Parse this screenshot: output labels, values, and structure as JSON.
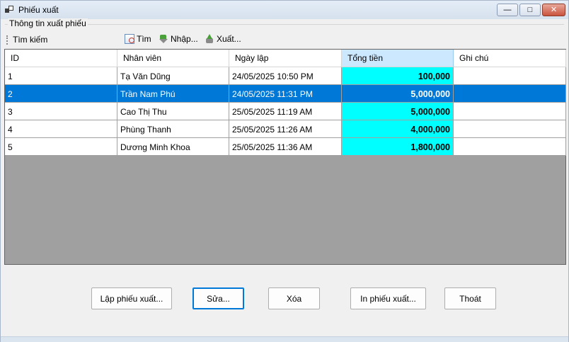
{
  "window": {
    "title": "Phiếu xuất",
    "minimize_glyph": "—",
    "maximize_glyph": "□",
    "close_glyph": "✕"
  },
  "group": {
    "title": "Thông tin xuất phiếu"
  },
  "toolbar": {
    "search_label": "Tìm kiếm",
    "find_label": "Tìm",
    "find_icon": "find-icon",
    "import_label": "Nhập...",
    "import_icon": "import-arrow-icon",
    "export_label": "Xuất...",
    "export_icon": "export-arrow-icon"
  },
  "grid": {
    "columns": [
      "ID",
      "Nhân viên",
      "Ngày lập",
      "Tổng tiền",
      "Ghi chú"
    ],
    "selected_column": 3,
    "selected_row": 1,
    "rows": [
      [
        "1",
        "Tạ Văn Dũng",
        "24/05/2025 10:50 PM",
        "100,000",
        ""
      ],
      [
        "2",
        "Trần Nam Phú",
        "24/05/2025 11:31 PM",
        "5,000,000",
        ""
      ],
      [
        "3",
        "Cao Thị Thu",
        "25/05/2025 11:19 AM",
        "5,000,000",
        ""
      ],
      [
        "4",
        "Phùng Thanh",
        "25/05/2025 11:26 AM",
        "4,000,000",
        ""
      ],
      [
        "5",
        "Dương Minh Khoa",
        "25/05/2025 11:36 AM",
        "1,800,000",
        ""
      ]
    ],
    "colors": {
      "money_bg": "#00ffff",
      "selected_bg": "#0078d7",
      "empty_bg": "#a0a0a0",
      "header_selected_bg": "#cce8ff"
    }
  },
  "buttons": {
    "create": "Lập phiếu xuất...",
    "edit": "Sửa...",
    "delete": "Xóa",
    "print": "In phiếu xuất...",
    "exit": "Thoát"
  }
}
